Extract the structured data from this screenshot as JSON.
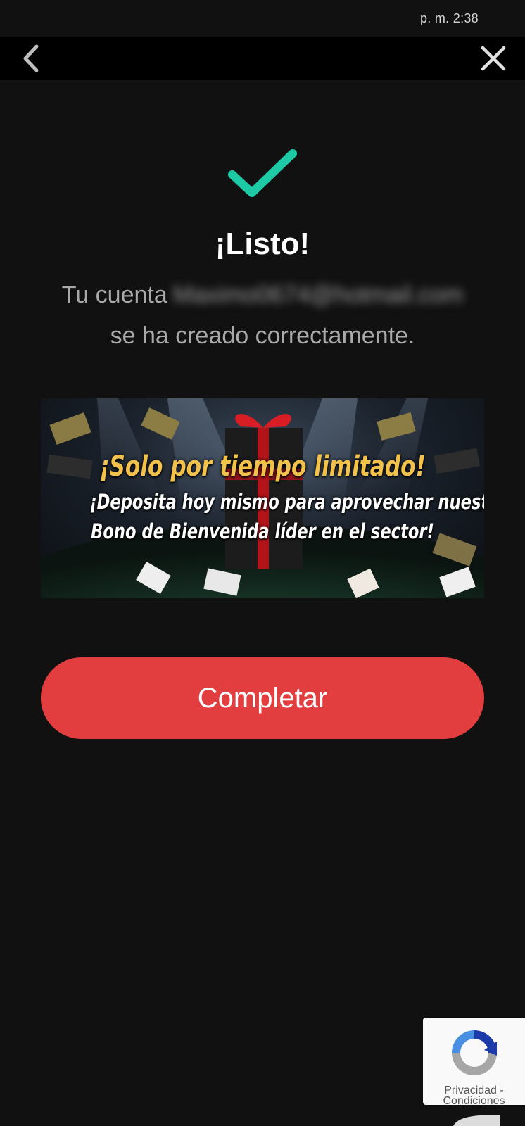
{
  "status_bar": {
    "time": "p. m. 2:38"
  },
  "nav": {
    "back_icon": "chevron-left-icon",
    "close_icon": "close-icon"
  },
  "success": {
    "icon": "checkmark-icon",
    "icon_color": "#1ec9a5",
    "title": "¡Listo!",
    "message_prefix": "Tu cuenta",
    "email_blurred": "Maximo0674@hotmail.com",
    "message_suffix": "se ha creado correctamente."
  },
  "promo": {
    "headline": "¡Solo por tiempo limitado!",
    "line1": "¡Deposita hoy mismo para aprovechar nuestro",
    "line2": "Bono de Bienvenida líder en el sector!",
    "headline_color": "#f3c24a"
  },
  "actions": {
    "complete_label": "Completar",
    "button_color": "#e23e3f"
  },
  "recaptcha": {
    "icon": "recaptcha-icon",
    "privacy": "Privacidad -",
    "terms": "Condiciones"
  }
}
